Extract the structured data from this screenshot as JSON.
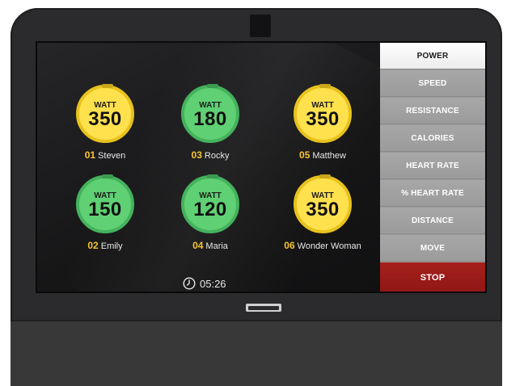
{
  "riders": [
    {
      "number": "01",
      "name": "Steven",
      "unit": "WATT",
      "value": "350",
      "color": "yellow"
    },
    {
      "number": "03",
      "name": "Rocky",
      "unit": "WATT",
      "value": "180",
      "color": "green"
    },
    {
      "number": "05",
      "name": "Matthew",
      "unit": "WATT",
      "value": "350",
      "color": "yellow"
    },
    {
      "number": "02",
      "name": "Emily",
      "unit": "WATT",
      "value": "150",
      "color": "green"
    },
    {
      "number": "04",
      "name": "Maria",
      "unit": "WATT",
      "value": "120",
      "color": "green"
    },
    {
      "number": "06",
      "name": "Wonder Woman",
      "unit": "WATT",
      "value": "350",
      "color": "yellow"
    }
  ],
  "timer": {
    "value": "05:26",
    "icon": "clock-icon"
  },
  "menu": {
    "items": [
      "POWER",
      "SPEED",
      "RESISTANCE",
      "CALORIES",
      "HEART RATE",
      "% HEART RATE",
      "DISTANCE",
      "MOVE"
    ],
    "active": "POWER",
    "stop_label": "STOP"
  },
  "colors": {
    "yellow_gauge": "#ffe14e",
    "green_gauge": "#5fd073",
    "rider_number": "#f5c531",
    "stop_button": "#a6201d"
  }
}
